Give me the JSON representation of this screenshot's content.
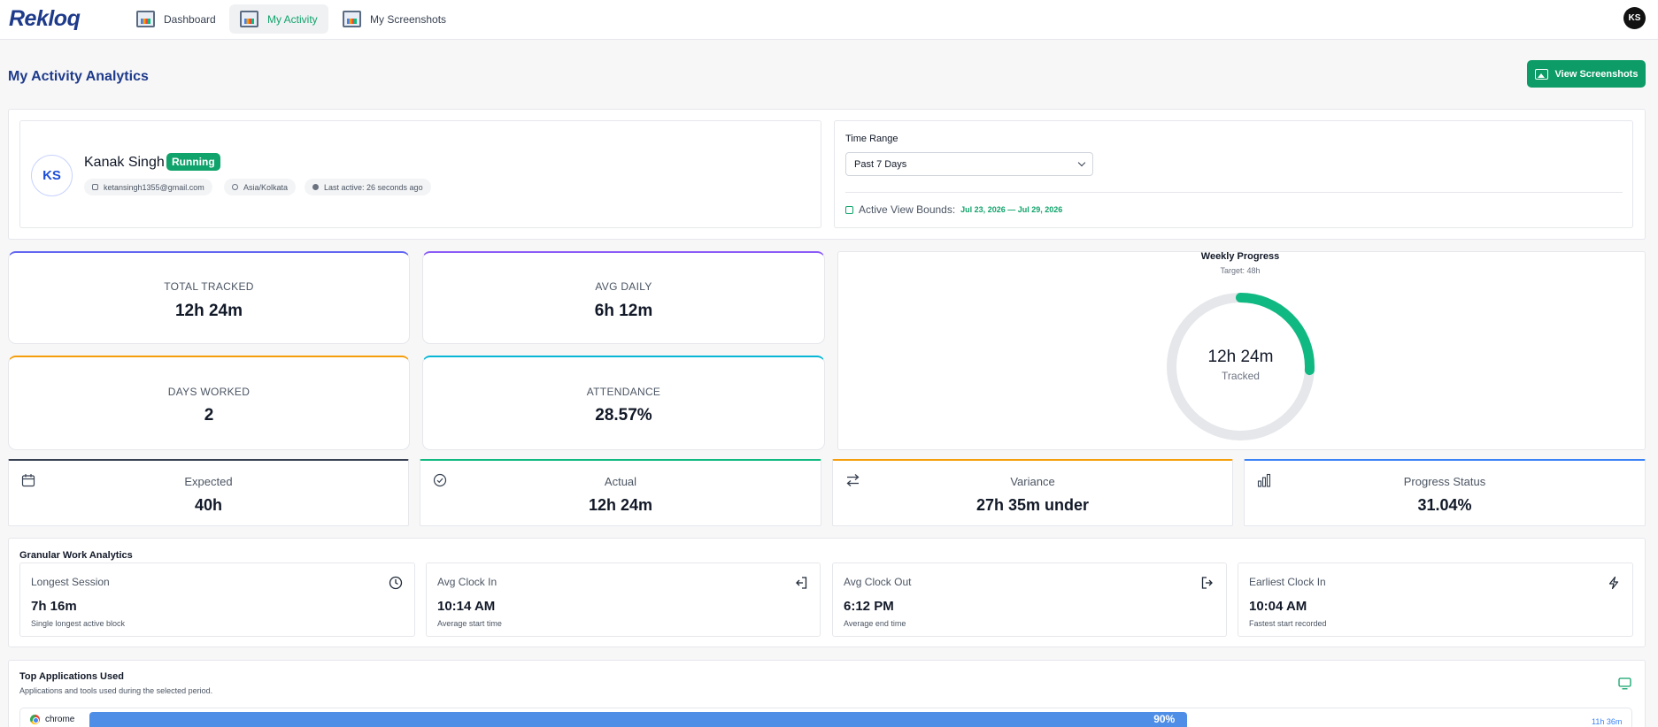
{
  "brand": {
    "logo_text": "Rekloq"
  },
  "nav": {
    "tabs": [
      {
        "label": "Dashboard",
        "icon": "dashboard-icon"
      },
      {
        "label": "My Activity",
        "icon": "activity-icon",
        "active": true
      },
      {
        "label": "My Screenshots",
        "icon": "screenshots-icon"
      }
    ],
    "user_initials": "KS"
  },
  "page": {
    "title": "My Activity Analytics",
    "view_button": "View Screenshots"
  },
  "profile": {
    "initials": "KS",
    "name": "Kanak Singh",
    "status": "Running",
    "email": "ketansingh1355@gmail.com",
    "timezone": "Asia/Kolkata",
    "last_active": "Last active: 26 seconds ago"
  },
  "time_range": {
    "label": "Time Range",
    "selected": "Past 7 Days",
    "bounds_label": "Active View Bounds:",
    "bounds_value": "Jul 23, 2026 — Jul 29, 2026"
  },
  "stats": [
    {
      "label": "TOTAL TRACKED",
      "value": "12h 24m",
      "accent": "#6366f1"
    },
    {
      "label": "AVG DAILY",
      "value": "6h 12m",
      "accent": "#8b5cf6"
    },
    {
      "label": "DAYS WORKED",
      "value": "2",
      "accent": "#f59e0b"
    },
    {
      "label": "ATTENDANCE",
      "value": "28.57%",
      "accent": "#06b6d4"
    }
  ],
  "weekly_progress": {
    "title": "Weekly Progress",
    "target": "Target: 48h",
    "value": "12h 24m",
    "sub": "Tracked",
    "progress_fraction": 0.2583,
    "track_color": "#e5e7eb",
    "fill_color": "#10b981"
  },
  "summary": [
    {
      "label": "Expected",
      "value": "40h",
      "icon": "calendar-icon",
      "accent": "#374151"
    },
    {
      "label": "Actual",
      "value": "12h 24m",
      "icon": "check-circle-icon",
      "accent": "#10b981"
    },
    {
      "label": "Variance",
      "value": "27h 35m under",
      "icon": "swap-icon",
      "accent": "#f59e0b"
    },
    {
      "label": "Progress Status",
      "value": "31.04%",
      "icon": "bar-chart-icon",
      "accent": "#3b82f6"
    }
  ],
  "granular": {
    "title": "Granular Work Analytics",
    "cards": [
      {
        "label": "Longest Session",
        "value": "7h 16m",
        "sub": "Single longest active block",
        "icon": "clock-icon"
      },
      {
        "label": "Avg Clock In",
        "value": "10:14 AM",
        "sub": "Average start time",
        "icon": "login-icon"
      },
      {
        "label": "Avg Clock Out",
        "value": "6:12 PM",
        "sub": "Average end time",
        "icon": "logout-icon"
      },
      {
        "label": "Earliest Clock In",
        "value": "10:04 AM",
        "sub": "Fastest start recorded",
        "icon": "lightning-icon"
      }
    ]
  },
  "apps": {
    "title": "Top Applications Used",
    "subtitle": "Applications and tools used during the selected period.",
    "items": [
      {
        "name": "chrome",
        "percent": "90%",
        "percent_value": 90,
        "time": "11h 36m",
        "color": "#4f8ee6"
      }
    ]
  }
}
